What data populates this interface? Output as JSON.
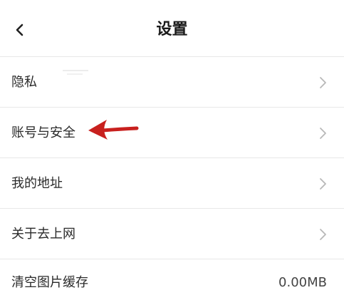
{
  "header": {
    "title": "设置",
    "back_icon": "chevron-left-icon"
  },
  "settings": {
    "items": [
      {
        "label": "隐私",
        "icon": "chevron-right-icon"
      },
      {
        "label": "账号与安全",
        "icon": "chevron-right-icon"
      },
      {
        "label": "我的地址",
        "icon": "chevron-right-icon"
      },
      {
        "label": "关于去上网",
        "icon": "chevron-right-icon"
      },
      {
        "label": "清空图片缓存",
        "value": "0.00MB"
      }
    ]
  },
  "colors": {
    "annotation_arrow": "#c8201e",
    "divider": "#e8e8e8",
    "chevron": "#b8b8b8"
  }
}
